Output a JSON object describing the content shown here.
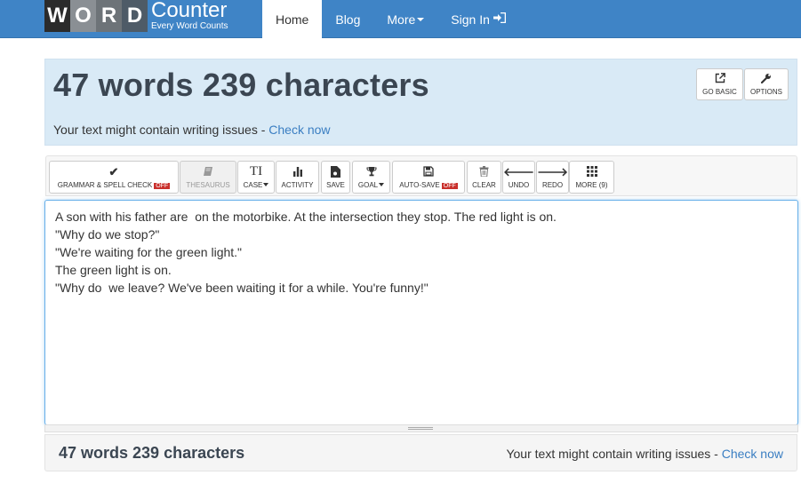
{
  "logo": {
    "letters": [
      "W",
      "O",
      "R",
      "D"
    ],
    "letter_colors": [
      "#2b2b2b",
      "#8a8f94",
      "#6d7378",
      "#4e5b67"
    ],
    "main": "Counter",
    "sub": "Every Word Counts"
  },
  "nav": {
    "home": "Home",
    "blog": "Blog",
    "more": "More",
    "signin": "Sign In"
  },
  "header": {
    "headline": "47 words 239 characters",
    "issue_text": "Your text might contain writing issues - ",
    "issue_link": "Check now",
    "go_basic": "GO BASIC",
    "options": "OPTIONS"
  },
  "toolbar": {
    "grammar": "GRAMMAR & SPELL CHECK",
    "grammar_state": "OFF",
    "thesaurus": "THESAURUS",
    "case": "CASE",
    "case_icon": "TI",
    "activity": "ACTIVITY",
    "save": "SAVE",
    "goal": "GOAL",
    "autosave": "AUTO-SAVE",
    "autosave_state": "OFF",
    "clear": "CLEAR",
    "undo": "UNDO",
    "redo": "REDO",
    "more": "MORE (9)"
  },
  "editor": {
    "lines": [
      "A son with his father are  on the motorbike. At the intersection they stop. The red light is on.",
      "\"Why do we stop?\"",
      "\"We're waiting for the green light.\"",
      "The green light is on.",
      "\"Why do  we leave? We've been waiting it for a while. You're funny!\""
    ]
  },
  "footer": {
    "count": "47 words 239 characters",
    "issue_text": "Your text might contain writing issues - ",
    "issue_link": "Check now"
  },
  "colors": {
    "navbar": "#3f84c6",
    "header_bg": "#d9eaf6",
    "link": "#3a7ec2",
    "off_badge": "#c9302c"
  }
}
